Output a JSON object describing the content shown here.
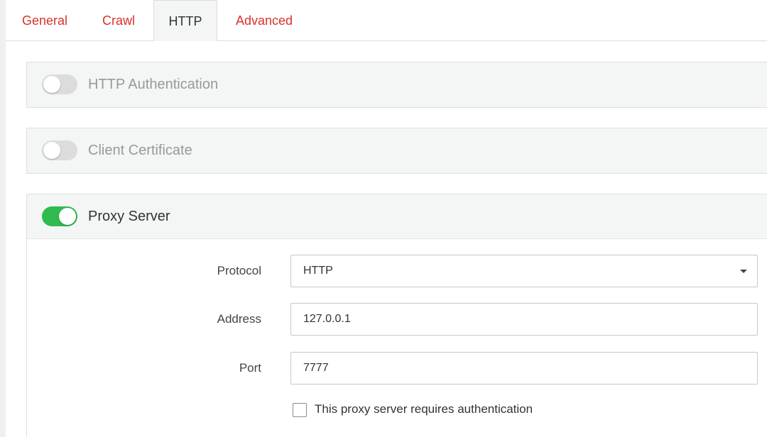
{
  "tabs": [
    {
      "label": "General",
      "active": false
    },
    {
      "label": "Crawl",
      "active": false
    },
    {
      "label": "HTTP",
      "active": true
    },
    {
      "label": "Advanced",
      "active": false
    }
  ],
  "panels": {
    "http_auth": {
      "title": "HTTP Authentication",
      "enabled": false
    },
    "client_cert": {
      "title": "Client Certificate",
      "enabled": false
    },
    "proxy": {
      "title": "Proxy Server",
      "enabled": true,
      "protocol": {
        "label": "Protocol",
        "value": "HTTP"
      },
      "address": {
        "label": "Address",
        "value": "127.0.0.1"
      },
      "port": {
        "label": "Port",
        "value": "7777"
      },
      "requires_auth": {
        "label": "This proxy server requires authentication",
        "checked": false
      }
    }
  },
  "colors": {
    "tab_link": "#d9312b",
    "toggle_on": "#2fbb4f",
    "toggle_off": "#dcdcdc",
    "panel_bg": "#f4f5f5"
  },
  "icons": {
    "select_caret": "caret-down-icon"
  }
}
